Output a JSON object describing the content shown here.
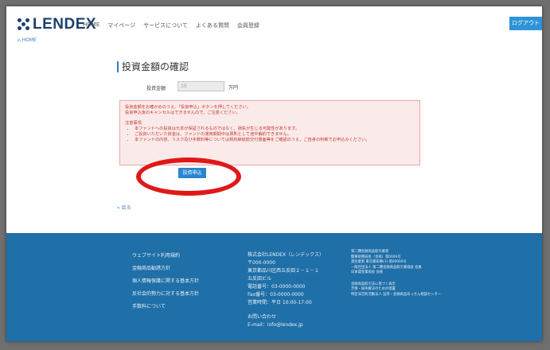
{
  "header": {
    "logo_text": "LENDEX",
    "nav": [
      "HOME",
      "マイページ",
      "サービスについて",
      "よくある質問",
      "会員登録"
    ],
    "logout_label": "ログアウト"
  },
  "breadcrumb": "HOME",
  "main": {
    "title": "投資金額の確認",
    "amount_label": "投資金額",
    "amount_value": "10",
    "amount_unit": "万円",
    "alert": {
      "line1": "投資金額をお確かめのうえ、「投資申込」ボタンを押してください。",
      "line2": "投資申込後のキャンセルはできませんので、ご注意ください。",
      "notes_title": "注意事項",
      "notes": [
        "本ファンドへの投資は元本が保証されるものではなく、損失が生じる可能性があります。",
        "ご投資いただいた資金は、ファンドの運用期間中は原則として途中解約できません。",
        "本ファンドの内容、リスク及び手数料等については契約締結前交付書面等をご確認のうえ、ご自身の判断でお申込みください。"
      ]
    },
    "invest_button_label": "投資申込",
    "back_link": "戻る"
  },
  "footer": {
    "links": [
      "ウェブサイト利用規約",
      "金融商品勧誘方針",
      "個人情報保護に関する基本方針",
      "反社会的勢力に対する基本方針",
      "手数料について"
    ],
    "company": [
      "株式会社LENDEX（レンデックス）",
      "〒000-0000",
      "東京都品川区西五反田２－１－１",
      "五反田ビル",
      "電話番号：03-0000-0000",
      "Fax番号：03-0000-0000",
      "営業時間：平日 10:00-17:00"
    ],
    "contact_title": "お問い合わせ",
    "contact_email": "E-mail：info@lendex.jp",
    "registration": [
      "第二種金融商品取引業者",
      "関東財務局長（金商）第0000号",
      "貸金業者 東京都知事(1) 第00000号",
      "一般社団法人 第二種金融商品取引業協会 会員",
      "日本貸金業協会 会員",
      "金融商品取引法に基づく表示",
      "苦情・紛争解決のための措置",
      "特定非営利活動法人 証券・金融商品あっせん相談センター"
    ]
  }
}
